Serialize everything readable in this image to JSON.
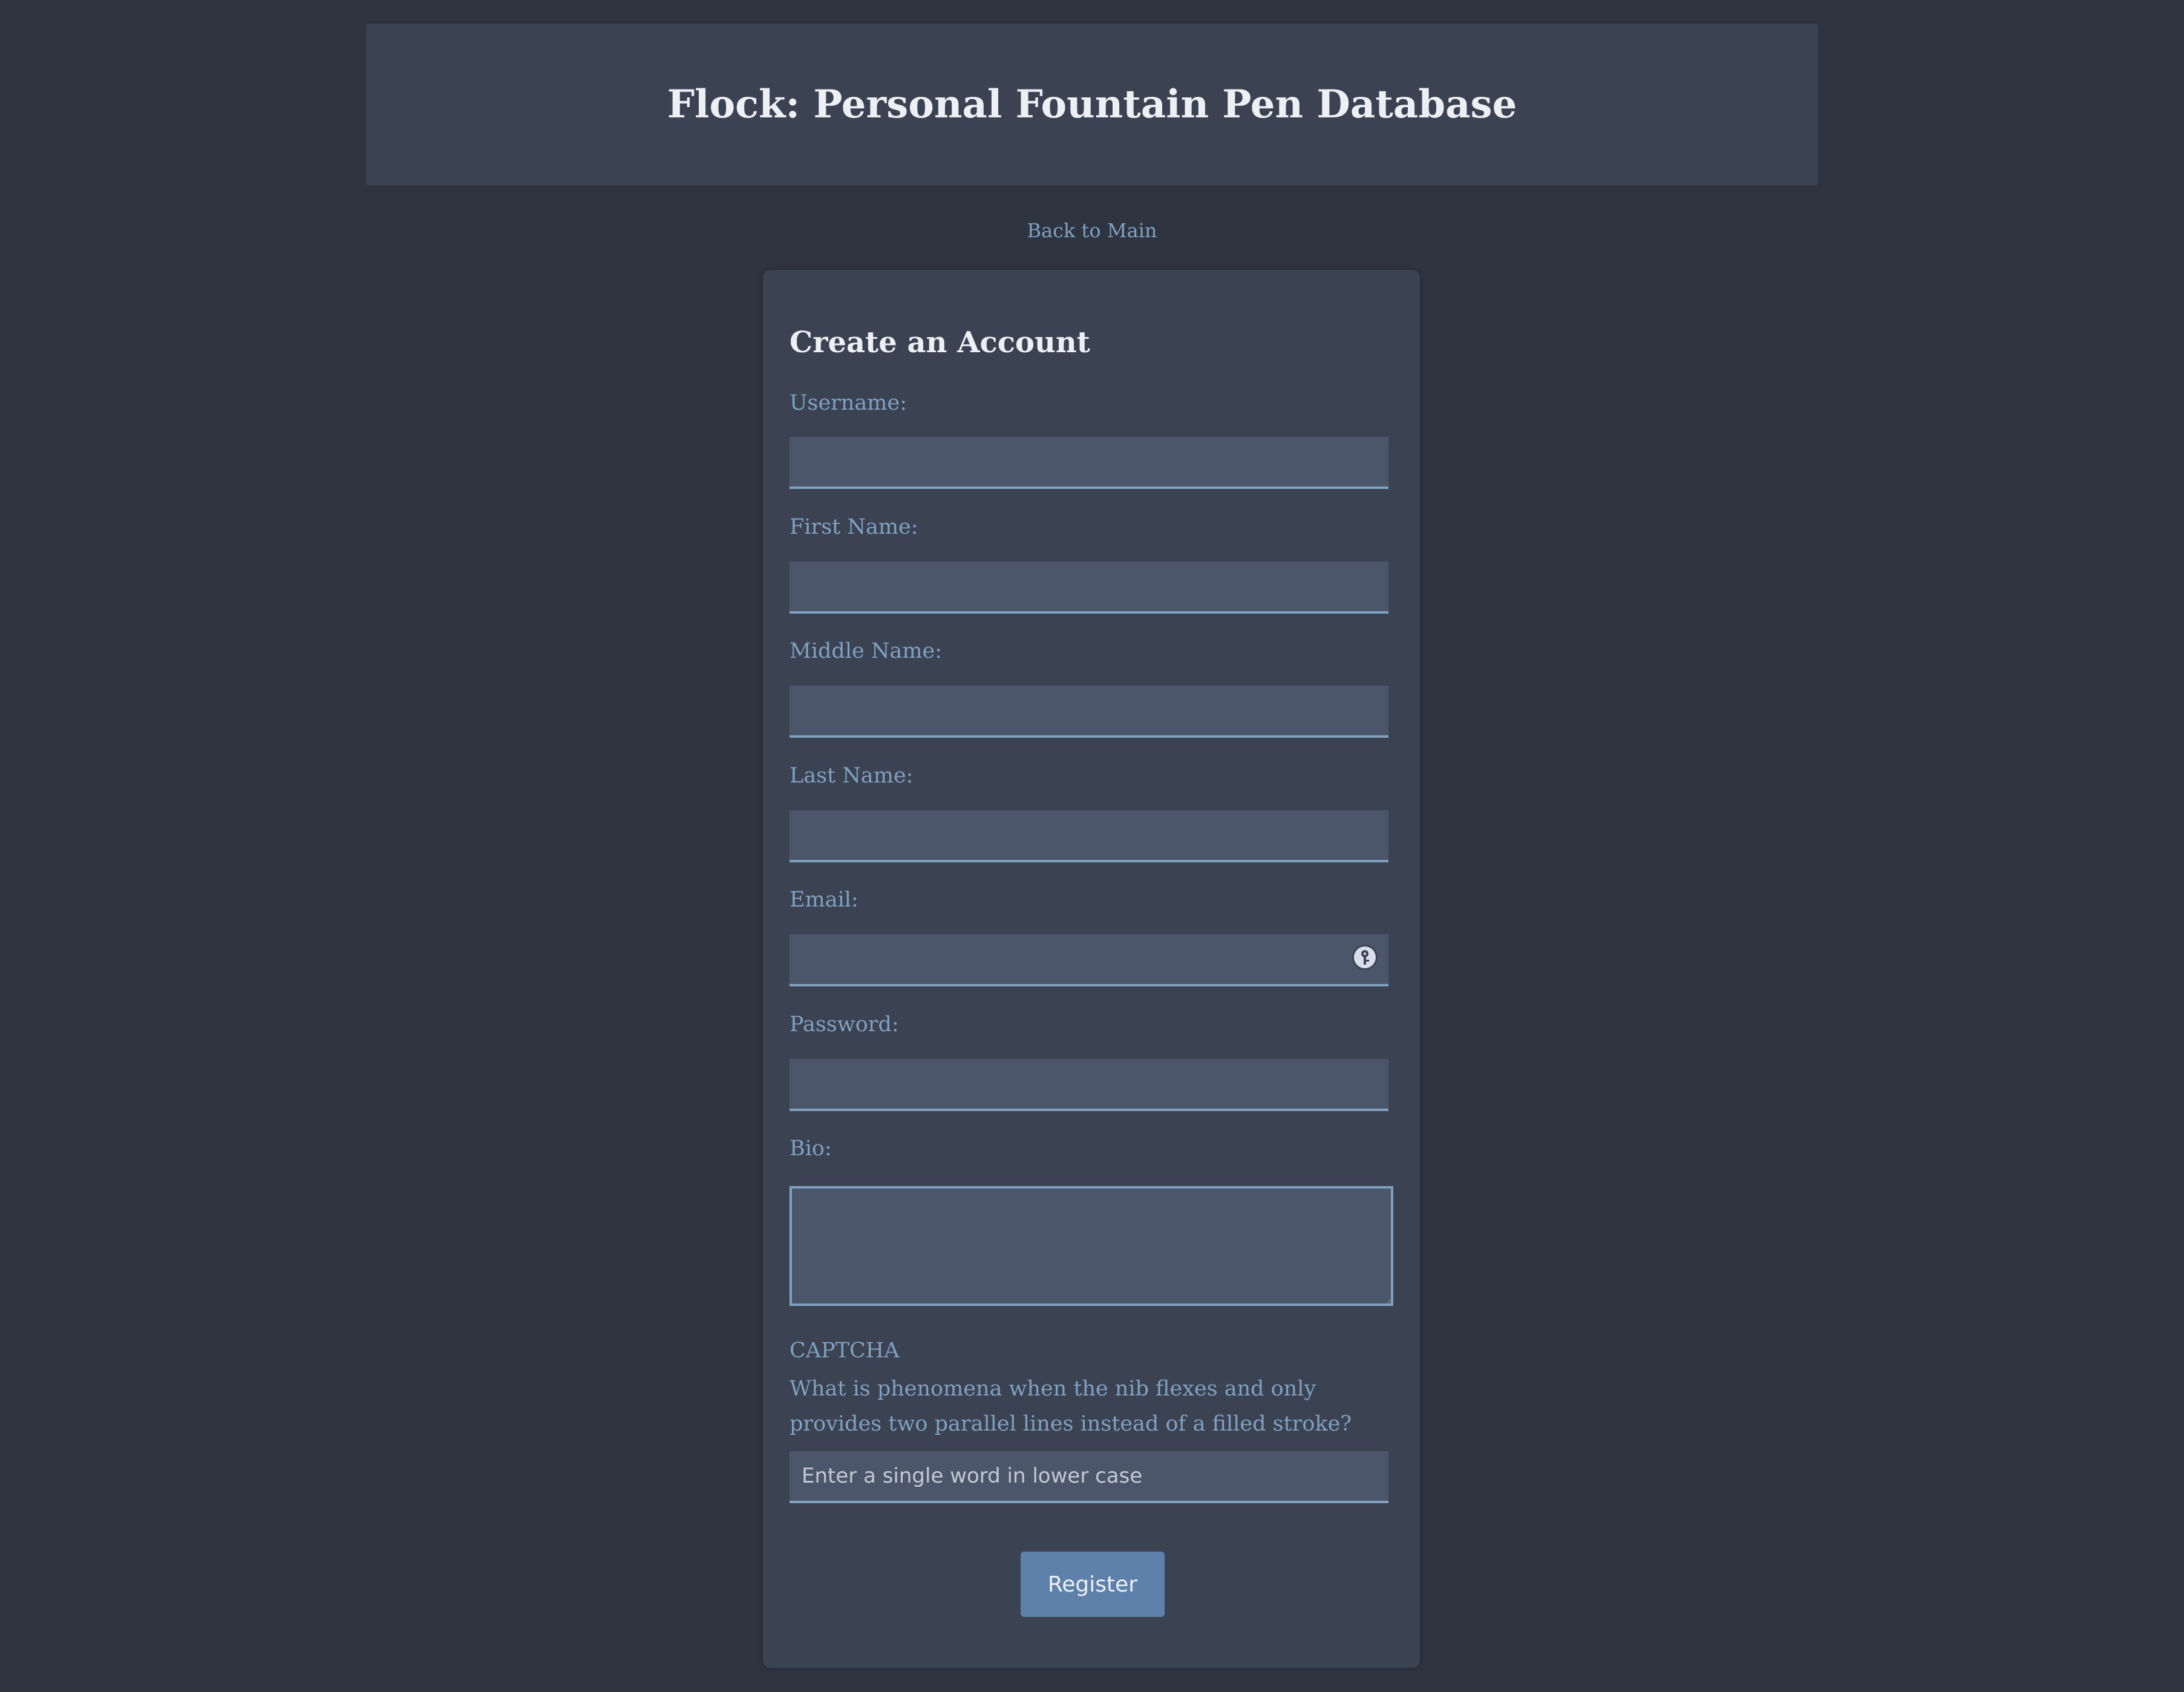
{
  "header": {
    "title": "Flock: Personal Fountain Pen Database"
  },
  "nav": {
    "back_label": "Back to Main"
  },
  "form": {
    "title": "Create an Account",
    "username_label": "Username:",
    "first_name_label": "First Name:",
    "middle_name_label": "Middle Name:",
    "last_name_label": "Last Name:",
    "email_label": "Email:",
    "password_label": "Password:",
    "bio_label": "Bio:",
    "captcha_heading": "CAPTCHA",
    "captcha_question": "What is phenomena when the nib flexes and only provides two parallel lines instead of a filled stroke?",
    "captcha_placeholder": "Enter a single word in lower case",
    "register_label": "Register"
  },
  "colors": {
    "background": "#2e3440",
    "panel": "#3b4252",
    "input": "#4c566a",
    "accent": "#81a1c1",
    "button": "#5e81ac",
    "text": "#eceff4"
  },
  "icons": {
    "email_field_icon": "password-manager-key-icon"
  }
}
